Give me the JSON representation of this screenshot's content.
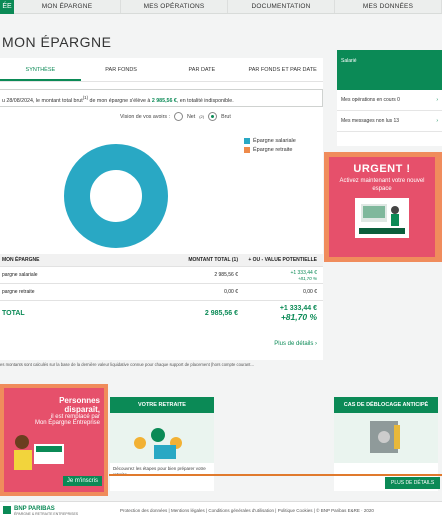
{
  "topnav": {
    "logo": "ÉE",
    "items": [
      "MON ÉPARGNE",
      "MES OPÉRATIONS",
      "DOCUMENTATION",
      "MES DONNÉES"
    ]
  },
  "page_title": "MON ÉPARGNE",
  "tabs": [
    "SYNTHÈSE",
    "PAR FONDS",
    "PAR DATE",
    "PAR FONDS ET PAR DATE"
  ],
  "info": {
    "prefix": "u 28/08/2024, le montant total brut",
    "sup": "(1)",
    "middle": " de mon épargne s'élève à ",
    "amount": "2 985,56 €",
    "suffix": ", en totalité indisponible."
  },
  "view": {
    "label": "Vision de vos avoirs :",
    "option_net": "Net",
    "option_net_sup": "(2)",
    "option_brut": "Brut"
  },
  "legend": [
    {
      "label": "Épargne salariale",
      "color": "#29a8c4"
    },
    {
      "label": "Épargne retraite",
      "color": "#ee8a4a"
    }
  ],
  "chart_data": {
    "type": "pie",
    "categories": [
      "Épargne salariale",
      "Épargne retraite"
    ],
    "values": [
      2985.56,
      0.0
    ],
    "colors": [
      "#29a8c4",
      "#ee8a4a"
    ],
    "legend_position": "right"
  },
  "table": {
    "headers": [
      "MON ÉPARGNE",
      "MONTANT TOTAL (1)",
      "+ OU - VALUE POTENTIELLE"
    ],
    "rows": [
      {
        "label": "pargne salariale",
        "amount": "2 985,56 €",
        "gain": "+1 333,44 €",
        "gain_pct": "+81,70 %"
      },
      {
        "label": "pargne retraite",
        "amount": "0,00 €",
        "gain": "0,00 €",
        "gain_pct": ""
      }
    ],
    "total": {
      "label": "TOTAL",
      "amount": "2 985,56 €",
      "gain": "+1 333,44 €",
      "gain_pct": "+81,70 %"
    }
  },
  "details_link": "Plus de détails",
  "footnote": "es montants sont calculés sur la base de la dernière valeur liquidative connue pour chaque support de placement (hors compte courant...",
  "side_panel": {
    "header": "Salarié",
    "links": [
      {
        "label": "Mes opérations en cours",
        "count": "0"
      },
      {
        "label": "Mes messages non lus",
        "count": "13"
      }
    ]
  },
  "urgent": {
    "title": "URGENT !",
    "text": "Activez maintenant votre nouvel espace",
    "card_caption": "Bienvenue sur Mon Épargne Entreprise"
  },
  "promo_left": {
    "line1": "Personnes",
    "line2": "disparaît,",
    "line3": "il est remplacé par",
    "line4": "Mon Épargne Entreprise",
    "cta": "Je m'inscris"
  },
  "tiles": [
    {
      "title": "VOTRE RETRAITE",
      "text": "Découvrez les étapes pour bien préparer votre retraite"
    },
    {
      "title": "CAS DE DÉBLOCAGE ANTICIPÉ",
      "text": ""
    }
  ],
  "tile_button": "PLUS DE DÉTAILS",
  "footer": {
    "brand": "BNP PARIBAS",
    "brand_sub": "ÉPARGNE & RETRAITE ENTREPRISES",
    "links": "Protection des données | Mentions légales | Conditions générales d'utilisation | Politique Cookies | © BNP Paribas E&RE · 2020"
  }
}
